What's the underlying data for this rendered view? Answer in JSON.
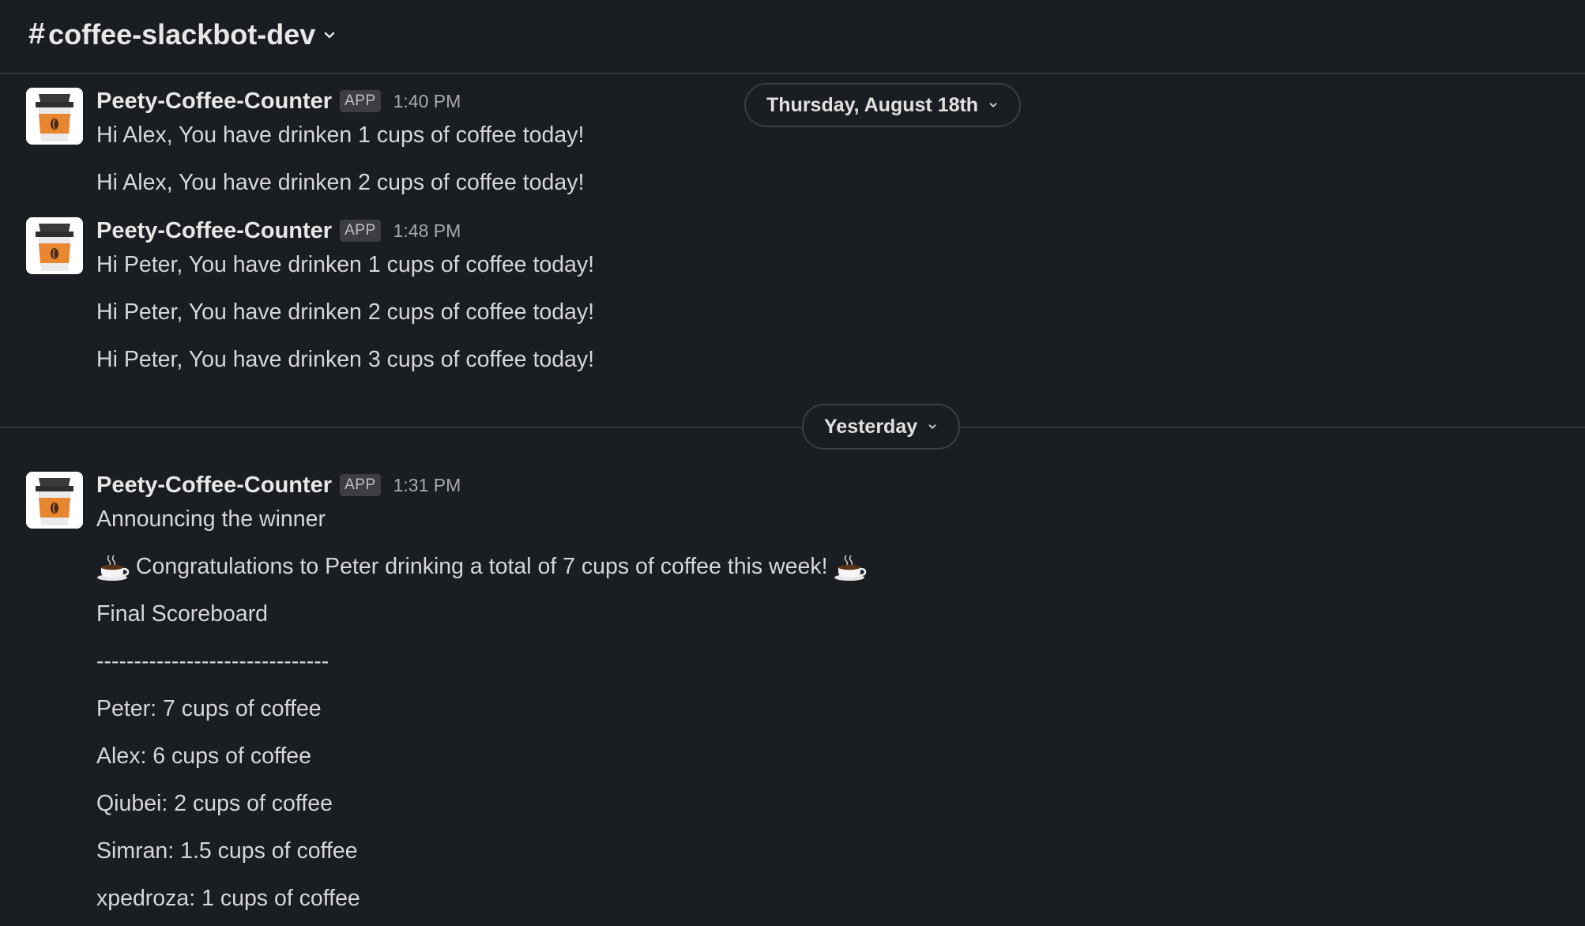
{
  "channel": {
    "hash": "#",
    "name": "coffee-slackbot-dev"
  },
  "dividers": [
    {
      "label": "Thursday, August 18th"
    },
    {
      "label": "Yesterday"
    }
  ],
  "messages": [
    {
      "sender": "Peety-Coffee-Counter",
      "badge": "APP",
      "time": "1:40 PM",
      "lines": [
        "Hi Alex, You have drinken 1 cups of coffee today!",
        "Hi Alex, You have drinken 2 cups of coffee today!"
      ]
    },
    {
      "sender": "Peety-Coffee-Counter",
      "badge": "APP",
      "time": "1:48 PM",
      "lines": [
        "Hi Peter, You have drinken 1 cups of coffee today!",
        "Hi Peter, You have drinken 2 cups of coffee today!",
        "Hi Peter, You have drinken 3 cups of coffee today!"
      ]
    },
    {
      "sender": "Peety-Coffee-Counter",
      "badge": "APP",
      "time": "1:31 PM",
      "lines": [
        "Announcing the winner",
        "Congratulations to Peter drinking a total of 7 cups of coffee this week!",
        "Final Scoreboard",
        "-------------------------------",
        "Peter: 7 cups of coffee",
        "Alex: 6 cups of coffee",
        "Qiubei: 2 cups of coffee",
        "Simran: 1.5 cups of coffee",
        "xpedroza: 1 cups of coffee"
      ]
    }
  ],
  "icons": {
    "avatar": "coffee-cup-icon",
    "emoji": "hot-beverage-icon",
    "chevron": "chevron-down-icon"
  },
  "colors": {
    "background": "#1a1d21",
    "divider": "#35373b",
    "cup_orange": "#e8862f",
    "cup_lid": "#3a3a3a"
  }
}
